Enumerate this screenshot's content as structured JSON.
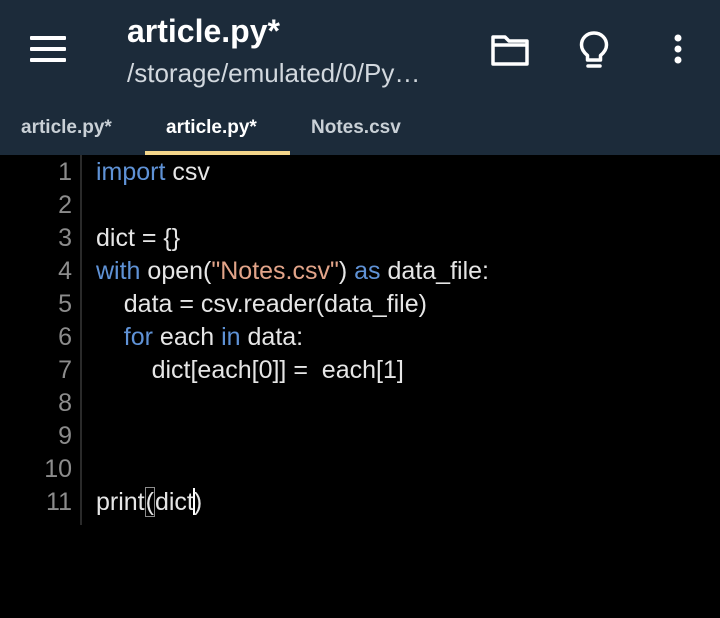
{
  "appbar": {
    "title": "article.py*",
    "subtitle": "/storage/emulated/0/Py…",
    "icons": [
      "menu-icon",
      "folder-icon",
      "lightbulb-icon",
      "more-vert-icon"
    ]
  },
  "tabs": [
    {
      "label": "article.py*",
      "active": false
    },
    {
      "label": "article.py*",
      "active": true
    },
    {
      "label": "Notes.csv",
      "active": false
    }
  ],
  "colors": {
    "bar": "#1c2b3a",
    "keyword": "#5f92d6",
    "string": "#e2a489",
    "accent": "#f3d58a"
  },
  "editor": {
    "line_numbers": [
      "1",
      "2",
      "3",
      "4",
      "5",
      "6",
      "7",
      "8",
      "9",
      "10",
      "11"
    ],
    "lines": {
      "l1": {
        "kw1": "import",
        "rest": " csv"
      },
      "l3": {
        "text": "dict = {}"
      },
      "l4": {
        "kw1": "with",
        "a": " open(",
        "str": "\"Notes.csv\"",
        "b": ") ",
        "kw2": "as",
        "c": " data_file:"
      },
      "l5": {
        "text": "    data = csv.reader(data_file)"
      },
      "l6": {
        "indent": "    ",
        "kw1": "for",
        "a": " each ",
        "kw2": "in",
        "b": " data:"
      },
      "l7": {
        "text": "        dict[each[0]] =  each[1]"
      },
      "l11": {
        "a": "print",
        "paren": "(",
        "b": "dict",
        "close": ")"
      }
    }
  }
}
